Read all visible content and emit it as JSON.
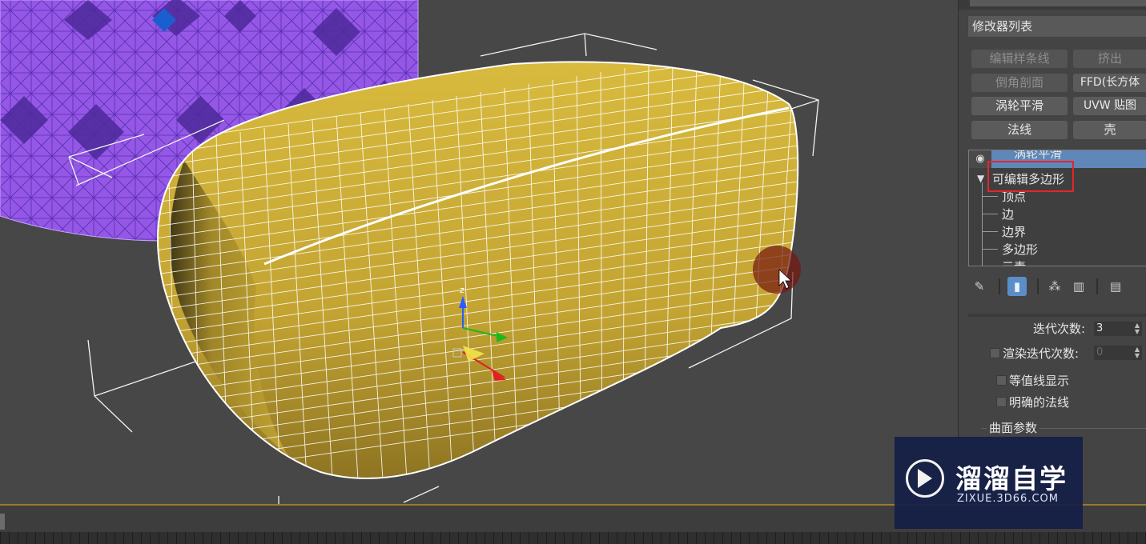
{
  "command_panel": {
    "modifier_list": "修改器列表",
    "buttons": [
      {
        "label": "编辑样条线",
        "enabled": false
      },
      {
        "label": "挤出",
        "enabled": false
      },
      {
        "label": "倒角剖面",
        "enabled": false
      },
      {
        "label": "FFD(长方体",
        "enabled": true
      },
      {
        "label": "涡轮平滑",
        "enabled": true
      },
      {
        "label": "UVW 贴图",
        "enabled": true
      },
      {
        "label": "法线",
        "enabled": true
      },
      {
        "label": "壳",
        "enabled": true
      }
    ],
    "stack": {
      "top_item": "涡轮平滑",
      "selected_item": "可编辑多边形",
      "sub_objects": [
        "顶点",
        "边",
        "边界",
        "多边形",
        "元素"
      ]
    },
    "toolbar_icons": [
      "pin-icon",
      "show-end-result-icon",
      "make-unique-icon",
      "remove-modifier-icon",
      "configure-modifier-sets-icon"
    ],
    "turbosmooth": {
      "iterations_label": "迭代次数:",
      "iterations_value": "3",
      "render_iters_label": "渲染迭代次数:",
      "render_iters_value": "0",
      "render_iters_checked": false,
      "isoline_label": "等值线显示",
      "isoline_checked": false,
      "explicit_normals_label": "明确的法线",
      "explicit_normals_checked": false,
      "surface_params_label": "曲面参数"
    }
  },
  "watermark": {
    "title": "溜溜自学",
    "subtitle": "ZIXUE.3D66.COM"
  },
  "colors": {
    "viewport_bg": "#474747",
    "cushion": "#c9ab34",
    "wire": "#ffffff",
    "purple_object": "#8e4fe0",
    "stack_highlight": "#5f87b7",
    "highlight_box": "#e2262c"
  }
}
